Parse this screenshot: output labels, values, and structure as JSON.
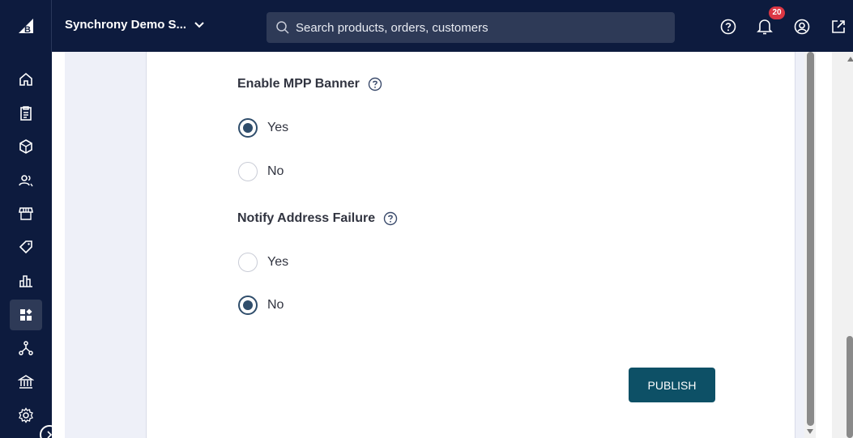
{
  "header": {
    "store_name": "Synchrony Demo S...",
    "search_placeholder": "Search products, orders, customers",
    "notification_count": "20"
  },
  "sidebar": {
    "items": [
      {
        "icon": "home-icon"
      },
      {
        "icon": "orders-icon"
      },
      {
        "icon": "products-icon"
      },
      {
        "icon": "customers-icon"
      },
      {
        "icon": "storefront-icon"
      },
      {
        "icon": "marketing-icon"
      },
      {
        "icon": "analytics-icon"
      },
      {
        "icon": "apps-icon",
        "active": true
      },
      {
        "icon": "channels-icon"
      },
      {
        "icon": "banking-icon"
      },
      {
        "icon": "settings-icon"
      }
    ]
  },
  "form": {
    "mpp_banner": {
      "title": "Enable MPP Banner",
      "options": [
        {
          "label": "Yes",
          "checked": true
        },
        {
          "label": "No",
          "checked": false
        }
      ]
    },
    "notify_address": {
      "title": "Notify Address Failure",
      "options": [
        {
          "label": "Yes",
          "checked": false
        },
        {
          "label": "No",
          "checked": true
        }
      ]
    },
    "publish_label": "PUBLISH"
  },
  "colors": {
    "header_bg": "#0d1b3e",
    "publish_bg": "#0d5066",
    "badge_bg": "#db3643"
  }
}
